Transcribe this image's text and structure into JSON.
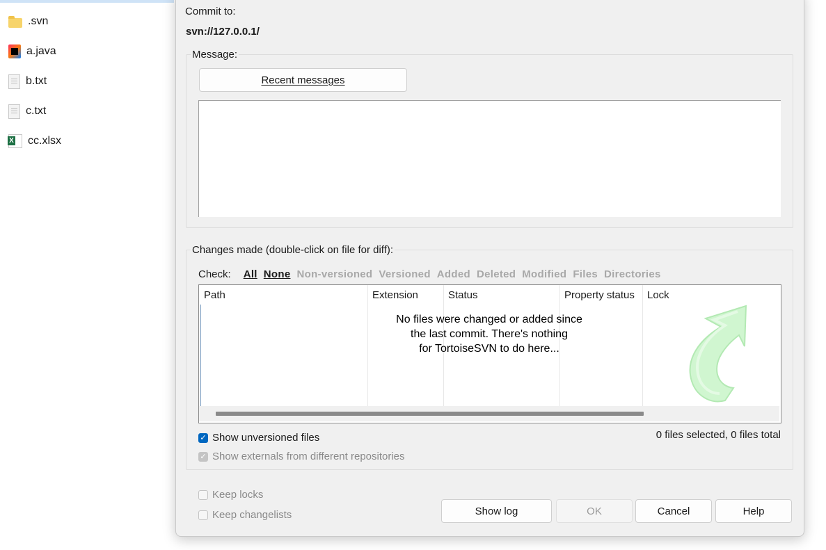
{
  "explorer": {
    "files": [
      {
        "name": ".svn",
        "icon": "folder-icon"
      },
      {
        "name": "a.java",
        "icon": "java-file-icon"
      },
      {
        "name": "b.txt",
        "icon": "text-file-icon"
      },
      {
        "name": "c.txt",
        "icon": "text-file-icon"
      },
      {
        "name": "cc.xlsx",
        "icon": "excel-file-icon"
      }
    ]
  },
  "dialog": {
    "commit_to_label": "Commit to:",
    "commit_url": "svn://127.0.0.1/",
    "message_group_title": "Message:",
    "recent_messages_button": "Recent messages",
    "message_text": "",
    "changes_group_title": "Changes made (double-click on file for diff):",
    "check_label": "Check:",
    "check_links": [
      {
        "label": "All",
        "active": true
      },
      {
        "label": "None",
        "active": true
      },
      {
        "label": "Non-versioned",
        "active": false
      },
      {
        "label": "Versioned",
        "active": false
      },
      {
        "label": "Added",
        "active": false
      },
      {
        "label": "Deleted",
        "active": false
      },
      {
        "label": "Modified",
        "active": false
      },
      {
        "label": "Files",
        "active": false
      },
      {
        "label": "Directories",
        "active": false
      }
    ],
    "columns": [
      "Path",
      "Extension",
      "Status",
      "Property status",
      "Lock"
    ],
    "empty_message_line1": "No files were changed or added since",
    "empty_message_line2": "the last commit. There's nothing",
    "empty_message_line3": "for TortoiseSVN to do here...",
    "show_unversioned_label": "Show unversioned files",
    "show_unversioned_checked": true,
    "show_externals_label": "Show externals from different repositories",
    "show_externals_checked": true,
    "files_status": "0 files selected, 0 files total",
    "keep_locks_label": "Keep locks",
    "keep_changelists_label": "Keep changelists",
    "buttons": {
      "show_log": "Show log",
      "ok": "OK",
      "cancel": "Cancel",
      "help": "Help"
    }
  },
  "colors": {
    "accent": "#0067c0",
    "dialog_bg": "#f0f0f0",
    "disabled_text": "#a8a8a8",
    "watermark_arrow": "#b8f0b8"
  }
}
